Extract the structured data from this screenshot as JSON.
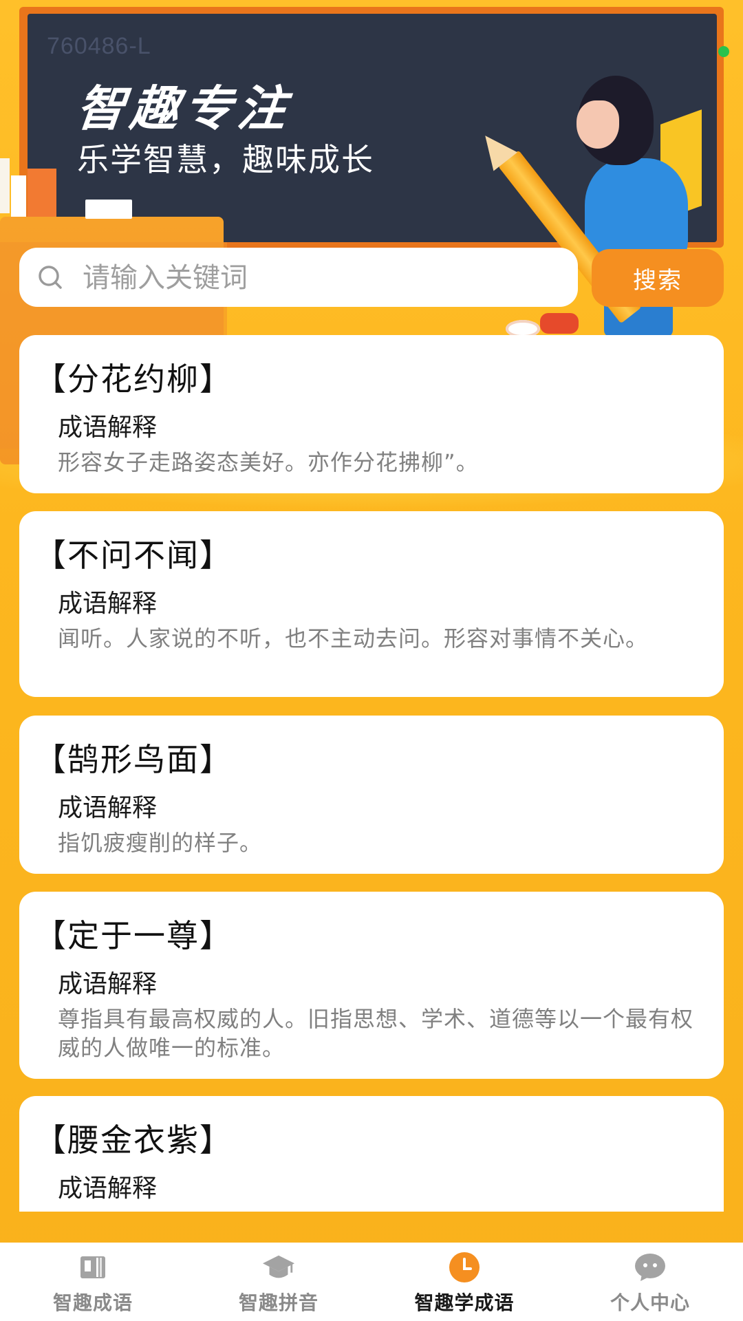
{
  "hero": {
    "board_id": "760486-L",
    "title": "智趣专注",
    "subtitle": "乐学智慧，趣味成长"
  },
  "search": {
    "placeholder": "请输入关键词",
    "button_label": "搜索"
  },
  "idioms": [
    {
      "title": "【分花约柳】",
      "label": "成语解释",
      "desc": "形容女子走路姿态美好。亦作分花拂柳”。"
    },
    {
      "title": "【不问不闻】",
      "label": "成语解释",
      "desc": "闻听。人家说的不听，也不主动去问。形容对事情不关心。"
    },
    {
      "title": "【鹄形鸟面】",
      "label": "成语解释",
      "desc": "指饥疲瘦削的样子。"
    },
    {
      "title": "【定于一尊】",
      "label": "成语解释",
      "desc": "尊指具有最高权威的人。旧指思想、学术、道德等以一个最有权威的人做唯一的标准。"
    },
    {
      "title": "【腰金衣紫】",
      "label": "成语解释",
      "desc": ""
    }
  ],
  "tabbar": {
    "tabs": [
      {
        "label": "智趣成语",
        "icon": "book-icon",
        "active": false
      },
      {
        "label": "智趣拼音",
        "icon": "graduation-cap-icon",
        "active": false
      },
      {
        "label": "智趣学成语",
        "icon": "clock-icon",
        "active": true
      },
      {
        "label": "个人中心",
        "icon": "chat-bubble-icon",
        "active": false
      }
    ]
  },
  "colors": {
    "background": "#F8B521",
    "accent": "#F58F20",
    "board": "#2D3546",
    "card": "#FFFFFF",
    "active_icon": "#F58F20",
    "inactive_icon": "#9B9B9B"
  }
}
